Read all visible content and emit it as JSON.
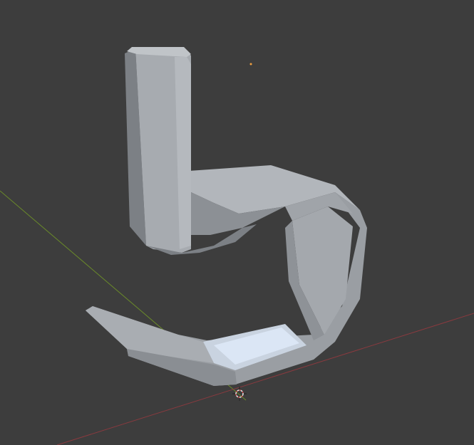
{
  "viewport": {
    "background": "#3d3d3d",
    "x_axis_color": "#8a3a3f",
    "y_axis_color": "#6a8a2a",
    "origin_color": "#f0a040",
    "mesh_light": "#b4b8bd",
    "mesh_mid": "#9a9ea3",
    "mesh_dark": "#7c8085",
    "highlight": "#dbe6f5"
  }
}
